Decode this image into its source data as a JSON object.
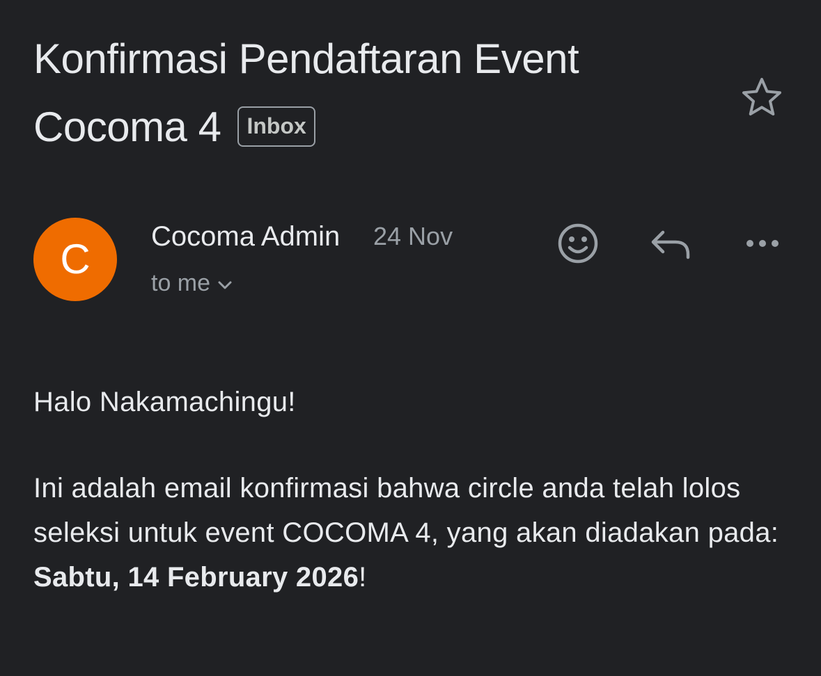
{
  "email": {
    "subject": "Konfirmasi Pendaftaran Event Cocoma 4",
    "label": "Inbox",
    "starred": false,
    "star_icon": "star-outline-icon",
    "sender": {
      "initial": "C",
      "name": "Cocoma Admin",
      "date": "24 Nov",
      "avatar_color": "#ef6c00"
    },
    "recipients_text": "to me",
    "actions": {
      "emoji_icon": "emoji-reaction-icon",
      "reply_icon": "reply-icon",
      "more_icon": "more-options-icon"
    },
    "body": {
      "greeting": "Halo Nakamachingu!",
      "paragraph": "Ini adalah email konfirmasi bahwa circle anda telah lolos seleksi untuk event COCOMA 4, yang akan diadakan pada:",
      "event_date": "Sabtu, 14 February 2026",
      "event_date_suffix": "!"
    }
  },
  "colors": {
    "background": "#202124",
    "text_primary": "#e8eaed",
    "text_secondary": "#9aa0a6",
    "accent_avatar": "#ef6c00"
  }
}
